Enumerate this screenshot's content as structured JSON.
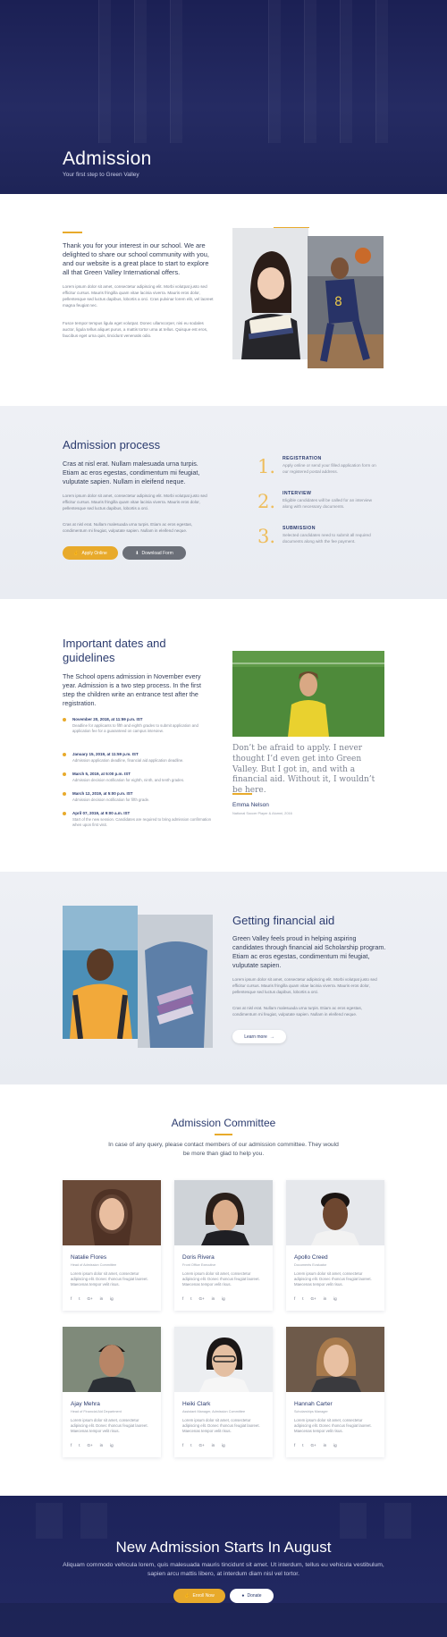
{
  "hero": {
    "title": "Admission",
    "subtitle": "Your first step to Green Valley"
  },
  "intro": {
    "lead": "Thank you for your interest in our school. We are delighted to share our school community with you, and our website is a great place to start to explore all that Green Valley International offers.",
    "p1": "Lorem ipsum dolor sit amet, consectetur adipiscing elit. Morbi volutpat justo sed efficitur cursus. Mauris fringilla quam vitae lacinia viverra. Mauris eros dolor, pellentesque sed luctus dapibus, lobortis a orci. Cras pulvinar lorem elit, vel laoreet magna feugiat nec.",
    "p2": "Fusce tempor tempus ligula eget volutpat. Donec ullamcorper, nisi eu sodales auctor, ligula tellus aliquet purus, a mattis tortor urna at tellus. Quisque est eros, faucibus eget urna quis, tincidunt venenatis odio."
  },
  "process": {
    "title": "Admission process",
    "lead": "Cras at nisl erat. Nullam malesuada urna turpis. Etiam ac eros egestas, condimentum mi feugiat, vulputate sapien. Nullam in eleifend neque.",
    "p1": "Lorem ipsum dolor sit amet, consectetur adipiscing elit. Morbi volutpat justo sed efficitur cursus. Mauris fringilla quam vitae lacinia viverra. Mauris eros dolor, pellentesque sed luctus dapibus, lobortis a orci.",
    "p2": "Cras at nisl erat. Nullam malesuada urna turpis. Etiam ac eros egestas, condimentum mi feugiat, vulputate sapien. Nullam in eleifend neque.",
    "apply_label": "Apply Online",
    "download_label": "Download Form",
    "steps": [
      {
        "num": "1.",
        "title": "REGISTRATION",
        "desc": "Apply online or send your filled application form on our registered postal address."
      },
      {
        "num": "2.",
        "title": "INTERVIEW",
        "desc": "Eligible candidates will be called for an interview along with necessary documents."
      },
      {
        "num": "3.",
        "title": "SUBMISSION",
        "desc": "Selected candidates need to submit all required documents along with the fee payment."
      }
    ]
  },
  "dates": {
    "title": "Important dates and guidelines",
    "lead": "The School opens admission in November every year. Admission is a two step process. In the first step the children write an entrance test after the registration.",
    "items": [
      {
        "date": "November 20, 2018, at 11:59 p.m. IST",
        "desc": "Deadline for applicants to fifth and eighth grades to submit application and application fee for a guaranteed on campus interview."
      },
      {
        "date": "January 15, 2019, at 11:59 p.m. IST",
        "desc": "Admission application deadline, financial aid application deadline."
      },
      {
        "date": "March 5, 2019, at 5:00 p.m. IST",
        "desc": "Admission decision notification for eighth, ninth, and tenth grades."
      },
      {
        "date": "March 12, 2019, at 5:00 p.m. IST",
        "desc": "Admission decision notification for fifth grade."
      },
      {
        "date": "April 07, 2019, at 9:00 a.m. IST",
        "desc": "Start of the new session. Candidates are required to bring admission confirmation when upon first visit."
      }
    ],
    "quote": "Don’t be afraid to apply. I never thought I’d even get into Green Valley. But I got in, and with a financial aid. Without it, I wouldn’t be here.",
    "quote_name": "Emma Nelson",
    "quote_role": "National Soccer Player & Alumni, 2016"
  },
  "aid": {
    "title": "Getting financial aid",
    "lead": "Green Valley feels proud in helping aspiring candidates through financial aid Scholarship program. Etiam ac eros egestas, condimentum mi feugiat, vulputate sapien.",
    "p1": "Lorem ipsum dolor sit amet, consectetur adipiscing elit. Morbi volutpat justo sed efficitur cursus. Mauris fringilla quam vitae lacinia viverra. Mauris eros dolor, pellentesque sed luctus dapibus, lobortis a orci.",
    "p2": "Cras at nisl erat. Nullam malesuada urna turpis. Etiam ac eros egestas, condimentum mi feugiat, vulputate sapien. Nullam in eleifend neque.",
    "learn_label": "Learn more"
  },
  "committee": {
    "title": "Admission Committee",
    "lead": "In case of any query, please contact members of our admission committee. They would be more than glad to help you.",
    "members": [
      {
        "name": "Natalie Flores",
        "role": "Head of Admission Committee",
        "bio": "Lorem ipsum dolor sit amet, consectetur adipiscing elit. Donec rhoncus feugiat laoreet. Maecenas tempor velit risus."
      },
      {
        "name": "Doris Rivera",
        "role": "Front Office Executive",
        "bio": "Lorem ipsum dolor sit amet, consectetur adipiscing elit. Donec rhoncus feugiat laoreet. Maecenas tempor velit risus."
      },
      {
        "name": "Apollo Creed",
        "role": "Documents Evaluator",
        "bio": "Lorem ipsum dolor sit amet, consectetur adipiscing elit. Donec rhoncus feugiat laoreet. Maecenas tempor velit risus."
      },
      {
        "name": "Ajay Mehra",
        "role": "Head of Financial Aid Department",
        "bio": "Lorem ipsum dolor sit amet, consectetur adipiscing elit. Donec rhoncus feugiat laoreet. Maecenas tempor velit risus."
      },
      {
        "name": "Heiki Clark",
        "role": "Assistant Manager, Admission Committee",
        "bio": "Lorem ipsum dolor sit amet, consectetur adipiscing elit. Donec rhoncus feugiat laoreet. Maecenas tempor velit risus."
      },
      {
        "name": "Hannah Carter",
        "role": "Scholarships Manager",
        "bio": "Lorem ipsum dolor sit amet, consectetur adipiscing elit. Donec rhoncus feugiat laoreet. Maecenas tempor velit risus."
      }
    ],
    "social": [
      "f",
      "t",
      "G+",
      "in",
      "ig"
    ]
  },
  "cta": {
    "title": "New Admission Starts In August",
    "text": "Aliquam commodo vehicula lorem, quis malesuada mauris tincidunt sit amet. Ut interdum, tellus eu vehicula vestibulum, sapien arcu mattis libero, at interdum diam nisl vel tortor.",
    "enroll_label": "Enroll Now",
    "donate_label": "Donate"
  },
  "colors": {
    "navy": "#1d235a",
    "gold": "#e8aa2b",
    "heading": "#2b3b6e"
  }
}
